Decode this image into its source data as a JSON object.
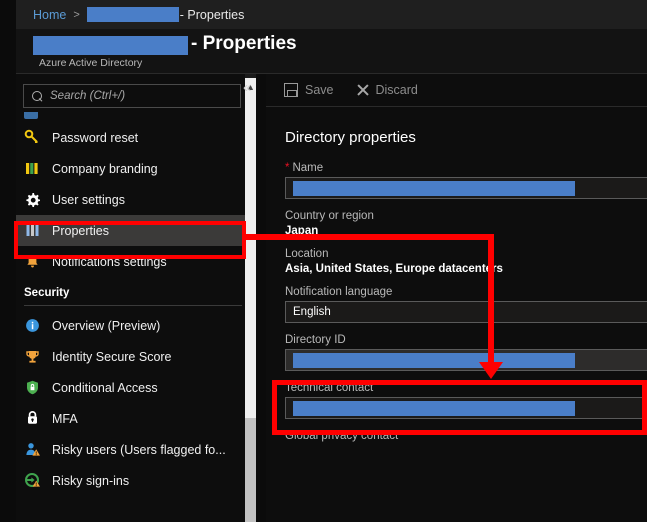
{
  "breadcrumb": {
    "home": "Home",
    "separator": ">",
    "redacted": true,
    "tail": "- Properties"
  },
  "header": {
    "title_suffix": "- Properties",
    "subtitle": "Azure Active Directory",
    "redacted_name": true
  },
  "sidebar": {
    "search": {
      "placeholder": "Search (Ctrl+/)",
      "value": "",
      "icon": "search-icon"
    },
    "collapse_icon": "«",
    "clipped_item_label": "",
    "items": [
      {
        "label": "Password reset",
        "icon": "key-icon",
        "selected": false
      },
      {
        "label": "Company branding",
        "icon": "branding-bars-icon",
        "selected": false
      },
      {
        "label": "User settings",
        "icon": "gear-icon",
        "selected": false
      },
      {
        "label": "Properties",
        "icon": "properties-bars-icon",
        "selected": true
      },
      {
        "label": "Notifications settings",
        "icon": "bell-icon",
        "selected": false
      }
    ],
    "security_section": {
      "heading": "Security",
      "items": [
        {
          "label": "Overview (Preview)",
          "icon": "info-circle-icon"
        },
        {
          "label": "Identity Secure Score",
          "icon": "trophy-icon"
        },
        {
          "label": "Conditional Access",
          "icon": "shield-lock-icon"
        },
        {
          "label": "MFA",
          "icon": "padlock-icon"
        },
        {
          "label": "Risky users (Users flagged fo...",
          "icon": "risky-user-icon"
        },
        {
          "label": "Risky sign-ins",
          "icon": "risky-signin-icon"
        }
      ]
    }
  },
  "toolbar": {
    "save_label": "Save",
    "save_icon": "save-floppy-icon",
    "discard_label": "Discard",
    "discard_icon": "close-x-icon"
  },
  "main": {
    "section_title": "Directory properties",
    "fields": [
      {
        "key": "name",
        "label": "Name",
        "required": true,
        "type": "input",
        "value": "",
        "redacted": true
      },
      {
        "key": "country",
        "label": "Country or region",
        "required": false,
        "type": "static",
        "value": "Japan"
      },
      {
        "key": "location",
        "label": "Location",
        "required": false,
        "type": "static",
        "value": "Asia, United States, Europe datacenters"
      },
      {
        "key": "notification_language",
        "label": "Notification language",
        "required": false,
        "type": "input",
        "value": "English",
        "redacted": false
      },
      {
        "key": "directory_id",
        "label": "Directory ID",
        "required": false,
        "type": "input-readonly",
        "value": "",
        "redacted": true
      },
      {
        "key": "technical_contact",
        "label": "Technical contact",
        "required": false,
        "type": "input",
        "value": "",
        "redacted": true
      },
      {
        "key": "global_privacy_contact",
        "label": "Global privacy contact",
        "required": false,
        "type": "static",
        "value": ""
      }
    ]
  },
  "annotations": {
    "color": "#ff0000",
    "highlight_source": "Properties",
    "highlight_target": "Directory ID"
  },
  "colors": {
    "redaction": "#4a7ec8",
    "link": "#5b9bd5",
    "annotation": "#ff0000",
    "required_star": "#e81123",
    "selected_row": "#3b3a39"
  }
}
